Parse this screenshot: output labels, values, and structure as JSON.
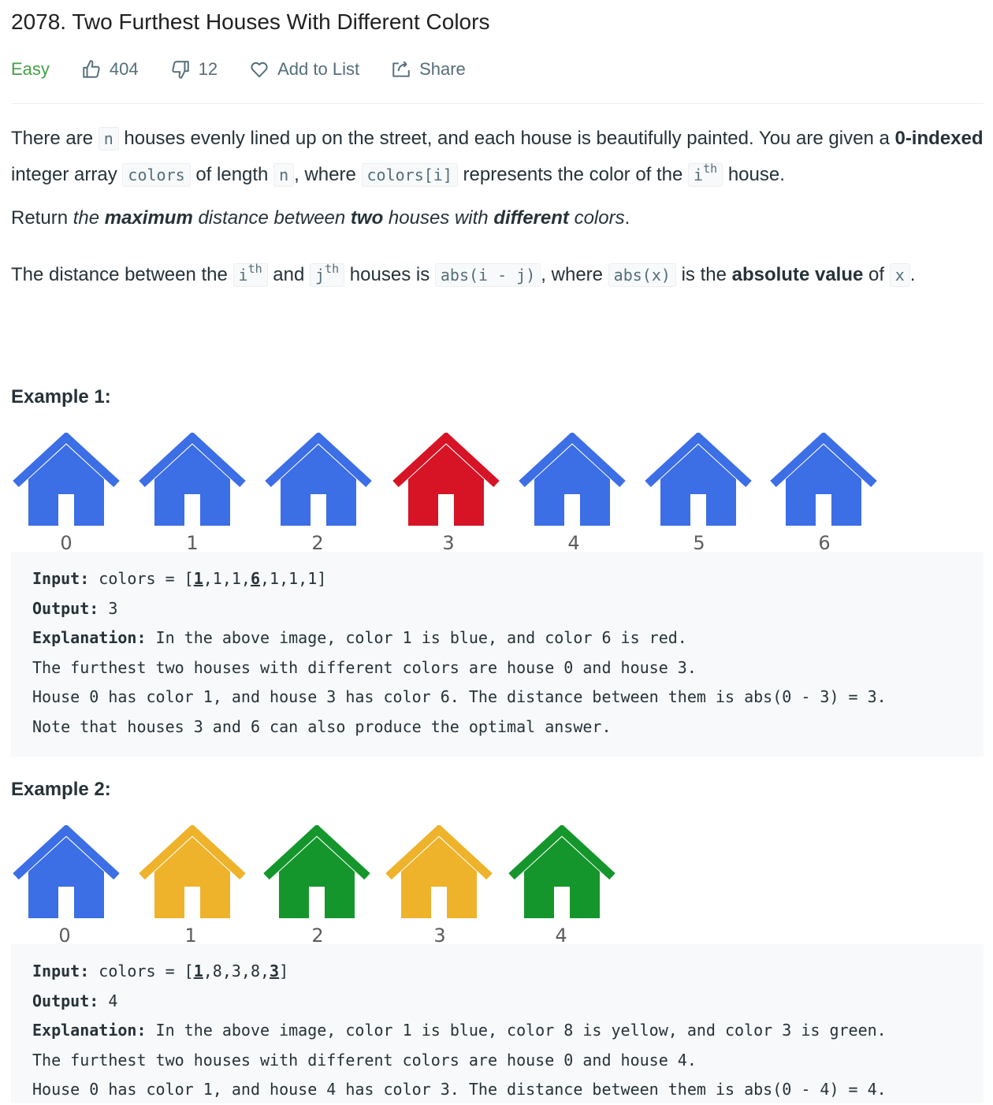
{
  "problem": {
    "title": "2078. Two Furthest Houses With Different Colors",
    "difficulty": "Easy",
    "likes": "404",
    "dislikes": "12",
    "add_to_list": "Add to List",
    "share": "Share"
  },
  "colors": {
    "difficulty_easy": "#43a047",
    "house_blue": "#3c6ee5",
    "house_red": "#d61426",
    "house_yellow": "#eeb32b",
    "house_green": "#14962c",
    "code_bg": "#f7f9fa"
  },
  "description": {
    "p1": {
      "t1": "There are ",
      "c1": "n",
      "t2": " houses evenly lined up on the street, and each house is beautifully painted. You are given a ",
      "b1": "0-indexed",
      "t3": " integer array ",
      "c2": "colors",
      "t4": " of length ",
      "c3": "n",
      "t5": ", where ",
      "c4": "colors[i]",
      "t6": " represents the color of the ",
      "c5_base": "i",
      "c5_sup": "th",
      "t7": " house."
    },
    "p2": {
      "t1": "Return ",
      "i1": "the ",
      "bi1": "maximum",
      "i2": " distance between ",
      "bi2": "two",
      "i3": " houses with ",
      "bi3": "different",
      "i4": " colors",
      "t2": "."
    },
    "p3": {
      "t1": "The distance between the ",
      "c1_base": "i",
      "c1_sup": "th",
      "t2": " and ",
      "c2_base": "j",
      "c2_sup": "th",
      "t3": " houses is ",
      "c3": "abs(i - j)",
      "t4": ", where ",
      "c4": "abs(x)",
      "t5": " is the ",
      "b1": "absolute value",
      "t6": " of ",
      "c5": "x",
      "t7": "."
    }
  },
  "example1": {
    "title": "Example 1:",
    "houses": [
      {
        "label": "0",
        "color": "blue"
      },
      {
        "label": "1",
        "color": "blue"
      },
      {
        "label": "2",
        "color": "blue"
      },
      {
        "label": "3",
        "color": "red"
      },
      {
        "label": "4",
        "color": "blue"
      },
      {
        "label": "5",
        "color": "blue"
      },
      {
        "label": "6",
        "color": "blue"
      }
    ],
    "input_label": "Input:",
    "input_pre": " colors = [",
    "input_u1": "1",
    "input_mid": ",1,1,",
    "input_u2": "6",
    "input_post": ",1,1,1]",
    "output_label": "Output:",
    "output_value": " 3",
    "explanation_label": "Explanation:",
    "explanation_1": " In the above image, color 1 is blue, and color 6 is red.",
    "explanation_2": "The furthest two houses with different colors are house 0 and house 3.",
    "explanation_3": "House 0 has color 1, and house 3 has color 6. The distance between them is abs(0 - 3) = 3.",
    "explanation_4": "Note that houses 3 and 6 can also produce the optimal answer."
  },
  "example2": {
    "title": "Example 2:",
    "houses": [
      {
        "label": "0",
        "color": "blue"
      },
      {
        "label": "1",
        "color": "yellow"
      },
      {
        "label": "2",
        "color": "green"
      },
      {
        "label": "3",
        "color": "yellow"
      },
      {
        "label": "4",
        "color": "green"
      }
    ],
    "input_label": "Input:",
    "input_pre": " colors = [",
    "input_u1": "1",
    "input_mid": ",8,3,8,",
    "input_u2": "3",
    "input_post": "]",
    "output_label": "Output:",
    "output_value": " 4",
    "explanation_label": "Explanation:",
    "explanation_1": " In the above image, color 1 is blue, color 8 is yellow, and color 3 is green.",
    "explanation_2": "The furthest two houses with different colors are house 0 and house 4.",
    "explanation_3": "House 0 has color 1, and house 4 has color 3. The distance between them is abs(0 - 4) = 4."
  }
}
